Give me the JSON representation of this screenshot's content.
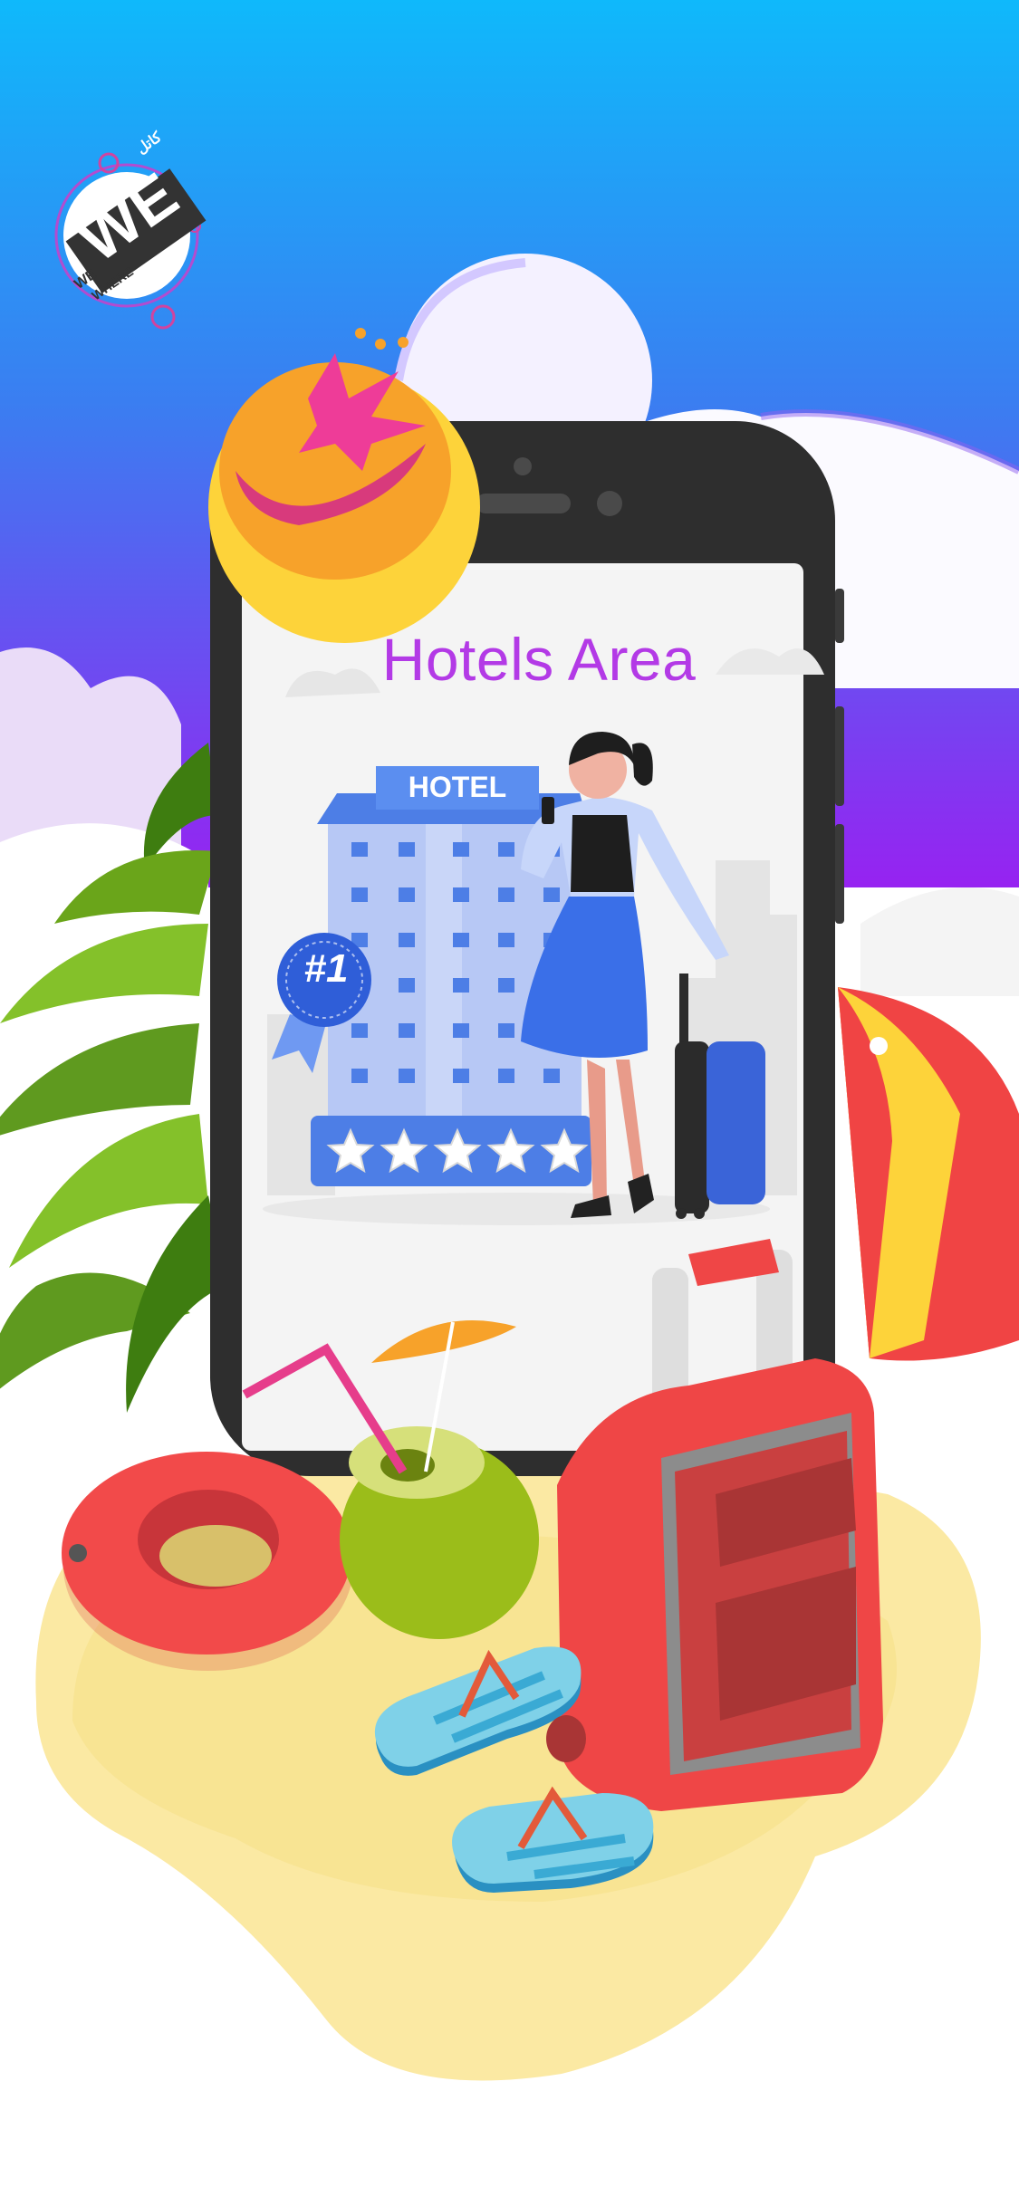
{
  "logo": {
    "main": "WE",
    "line1": "WE",
    "line2": "WHERE",
    "arabic": "كاتل",
    "icon": "we-logo-icon"
  },
  "screen": {
    "title": "Hotels Area",
    "hotel_sign": "HOTEL",
    "rank_badge": "#1",
    "star_count": 5
  },
  "colors": {
    "sky_top": "#0fb8fb",
    "sky_mid": "#3c7cf0",
    "sky_bottom": "#a01ef0",
    "title": "#b33ae6",
    "hotel_blue": "#4d7ee6",
    "suitcase_red": "#ef4646",
    "sand": "#fbe9a3"
  },
  "icons": [
    "sun-hat-icon",
    "palm-tree-icon",
    "beach-umbrella-icon",
    "swim-ring-icon",
    "coconut-drink-icon",
    "suitcase-icon",
    "flip-flops-icon",
    "hotel-building-icon",
    "traveler-icon",
    "star-rating-icon"
  ]
}
